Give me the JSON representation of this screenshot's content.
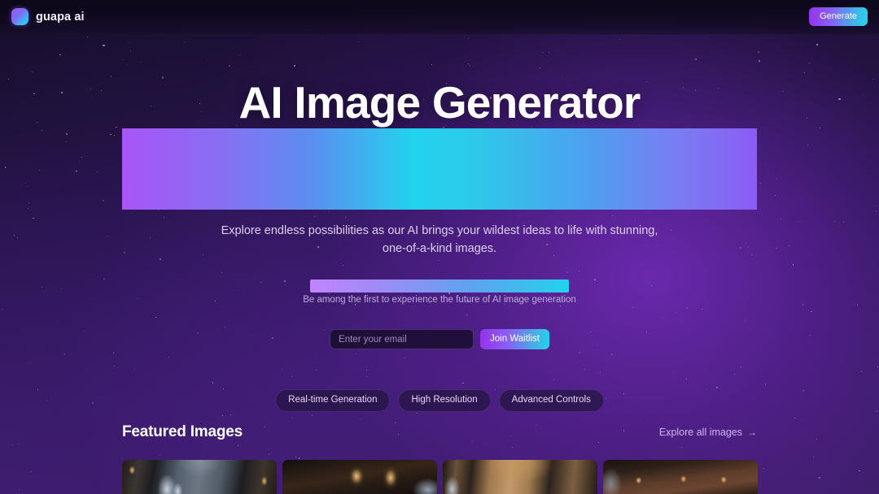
{
  "header": {
    "brand_name": "guapa ai",
    "logo_icon": "gradient-square-logo",
    "generate_label": "Generate"
  },
  "hero": {
    "title": "AI Image Generator",
    "banner_gradient": "#a855f7 → #22d3ee → #8b5cf6",
    "subtitle": "Explore endless possibilities as our AI brings your wildest ideas to life with stunning, one-of-a-kind images."
  },
  "waitlist": {
    "note": "Be among the first to experience the future of AI image generation",
    "email_placeholder": "Enter your email",
    "email_value": "",
    "submit_label": "Join Waitlist"
  },
  "features": [
    {
      "label": "Real-time Generation"
    },
    {
      "label": "High Resolution"
    },
    {
      "label": "Advanced Controls"
    }
  ],
  "featured": {
    "title": "Featured Images",
    "link_label": "Explore all images",
    "link_arrow": "→",
    "cards": [
      {
        "id": "card-1",
        "alt": "Gothic cathedral vaulted nave with stained glass"
      },
      {
        "id": "card-2",
        "alt": "Dark ornate hall with golden chandeliers"
      },
      {
        "id": "card-3",
        "alt": "Ochre stone vaulted ceiling arches"
      },
      {
        "id": "card-4",
        "alt": "Industrial brick loft with pendant lights"
      }
    ]
  },
  "theme": {
    "background": "#1b1033",
    "accent_purple": "#a855f7",
    "accent_cyan": "#22d3ee",
    "text_primary": "#ffffff",
    "text_muted": "#dcd1f0"
  }
}
